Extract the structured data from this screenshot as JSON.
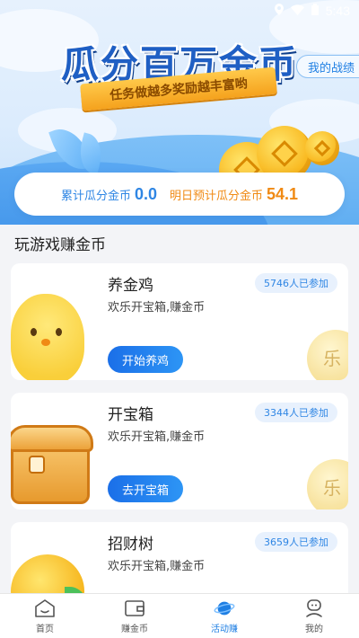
{
  "status_bar": {
    "time": "5:43",
    "icons": [
      "location-icon",
      "wifi-icon",
      "battery-icon"
    ]
  },
  "header": {
    "title": "瓜分百万金币",
    "ribbon": "任务做越多奖励越丰富哟",
    "record_button": "我的战绩"
  },
  "stats": {
    "total_label": "累计瓜分金币",
    "total_value": "0.0",
    "tomorrow_label": "明日预计瓜分金币",
    "tomorrow_value": "54.1"
  },
  "section": {
    "title": "玩游戏赚金币"
  },
  "games": [
    {
      "title": "养金鸡",
      "desc": "欢乐开宝箱,赚金币",
      "participants": "5746人已参加",
      "button": "开始养鸡"
    },
    {
      "title": "开宝箱",
      "desc": "欢乐开宝箱,赚金币",
      "participants": "3344人已参加",
      "button": "去开宝箱"
    },
    {
      "title": "招财树",
      "desc": "欢乐开宝箱,赚金币",
      "participants": "3659人已参加",
      "button": ""
    }
  ],
  "deco_glyph": "乐",
  "nav": [
    {
      "label": "首页",
      "icon": "home-icon"
    },
    {
      "label": "赚金币",
      "icon": "wallet-icon"
    },
    {
      "label": "活动赚",
      "icon": "planet-icon",
      "active": true
    },
    {
      "label": "我的",
      "icon": "profile-icon"
    }
  ],
  "colors": {
    "primary": "#2f86e4",
    "accent": "#f08a14",
    "title_blue": "#1f5fc4"
  }
}
